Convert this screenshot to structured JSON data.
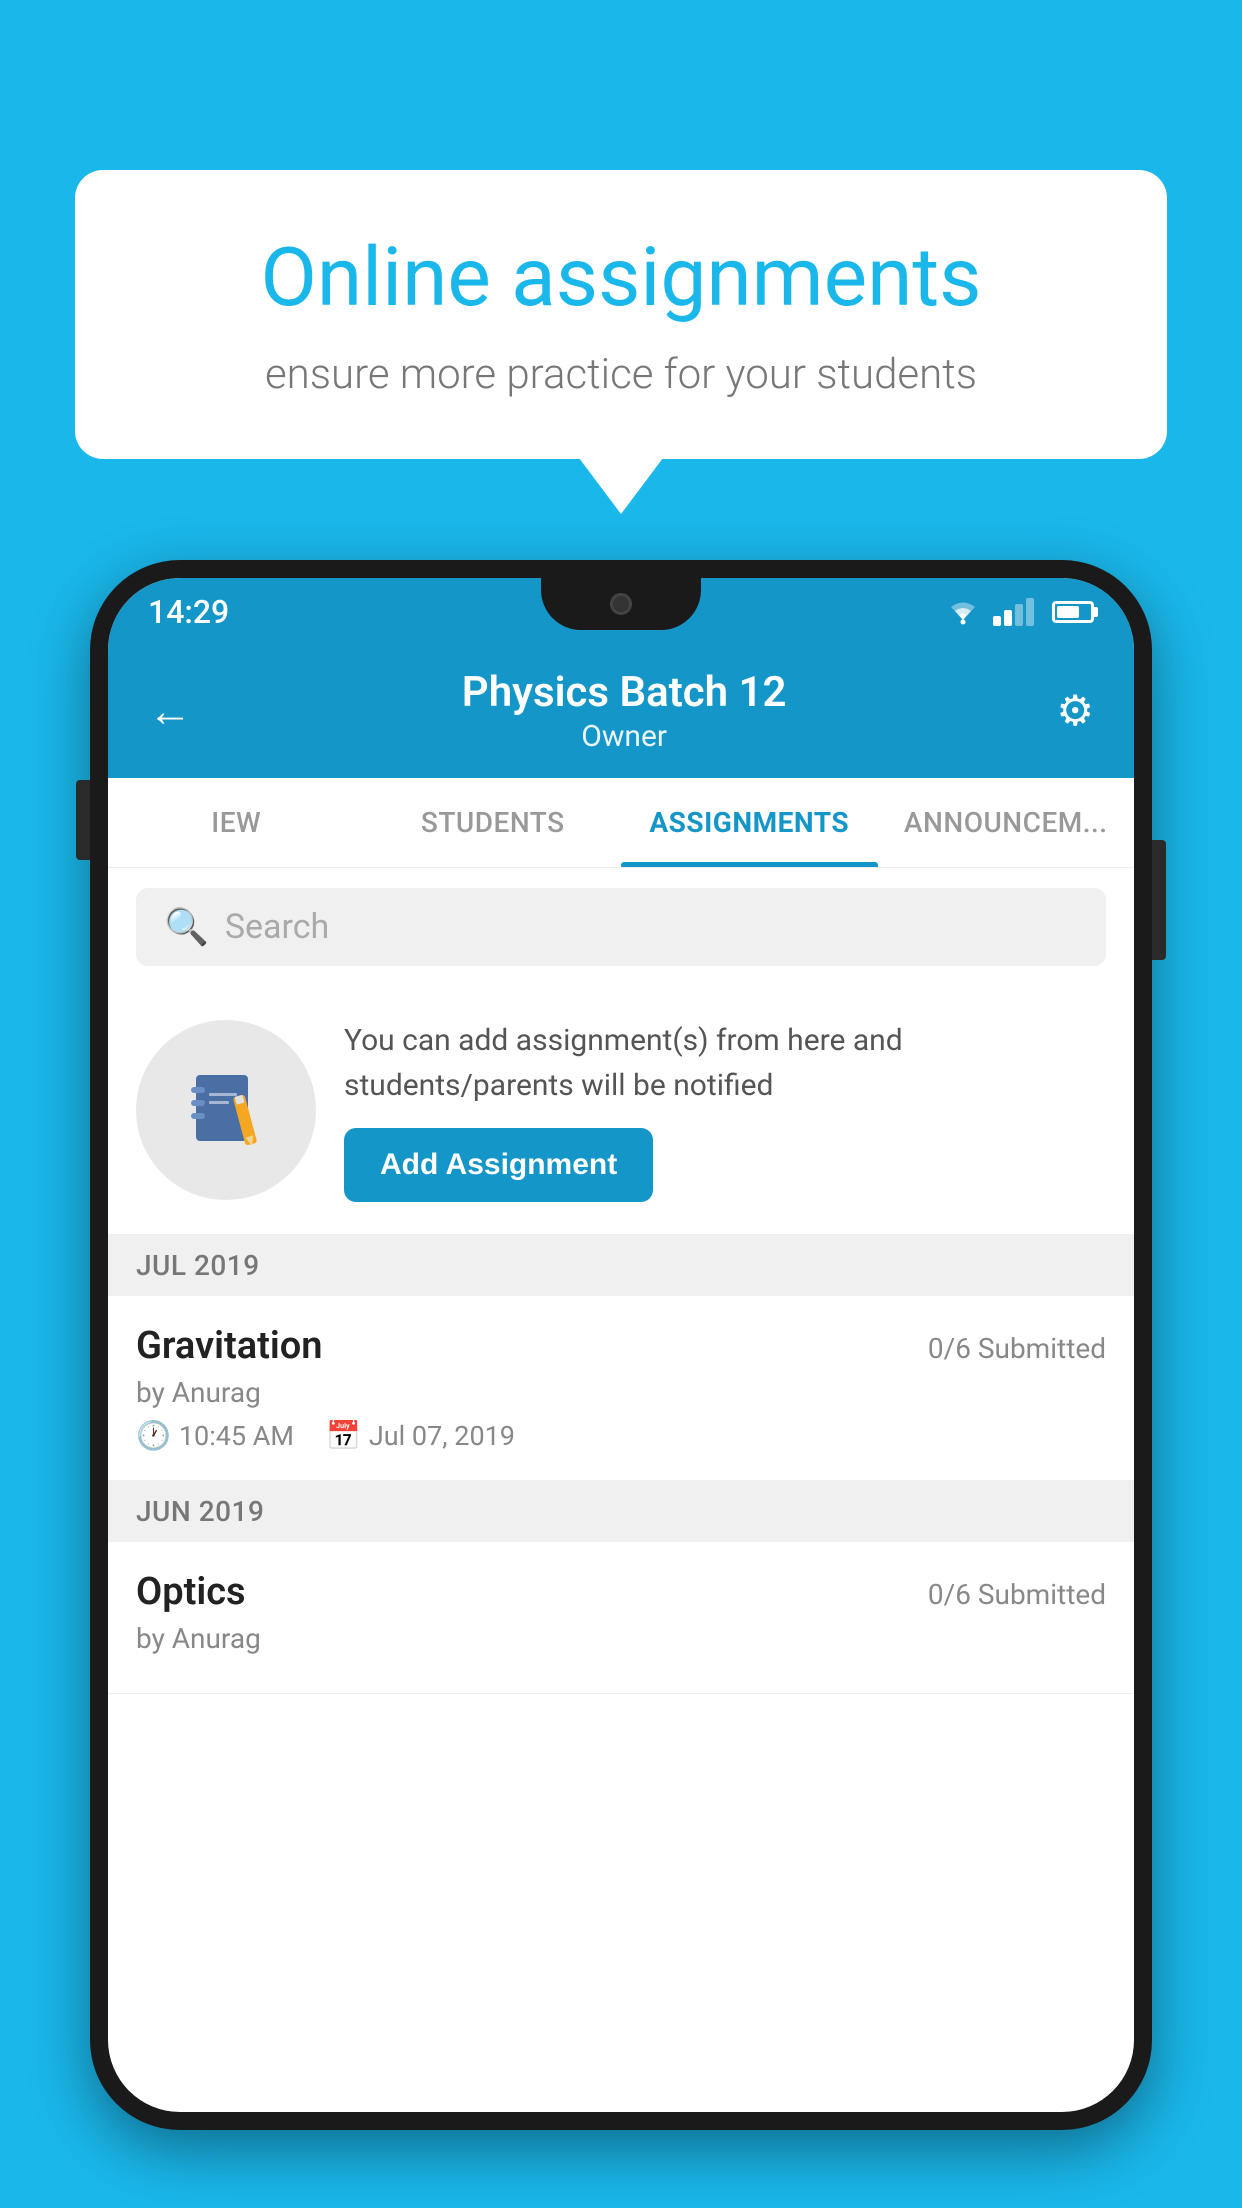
{
  "background_color": "#1ab7ea",
  "speech_bubble": {
    "title": "Online assignments",
    "subtitle": "ensure more practice for your students"
  },
  "phone": {
    "status_bar": {
      "time": "14:29"
    },
    "header": {
      "title": "Physics Batch 12",
      "subtitle": "Owner",
      "back_label": "←",
      "settings_label": "⚙"
    },
    "tabs": [
      {
        "label": "IEW",
        "active": false
      },
      {
        "label": "STUDENTS",
        "active": false
      },
      {
        "label": "ASSIGNMENTS",
        "active": true
      },
      {
        "label": "ANNOUNCEM...",
        "active": false
      }
    ],
    "search": {
      "placeholder": "Search"
    },
    "promo": {
      "description": "You can add assignment(s) from here and students/parents will be notified",
      "button_label": "Add Assignment"
    },
    "sections": [
      {
        "month_label": "JUL 2019",
        "assignments": [
          {
            "name": "Gravitation",
            "submitted": "0/6 Submitted",
            "by": "by Anurag",
            "time": "10:45 AM",
            "date": "Jul 07, 2019"
          }
        ]
      },
      {
        "month_label": "JUN 2019",
        "assignments": [
          {
            "name": "Optics",
            "submitted": "0/6 Submitted",
            "by": "by Anurag",
            "time": "",
            "date": ""
          }
        ]
      }
    ]
  }
}
